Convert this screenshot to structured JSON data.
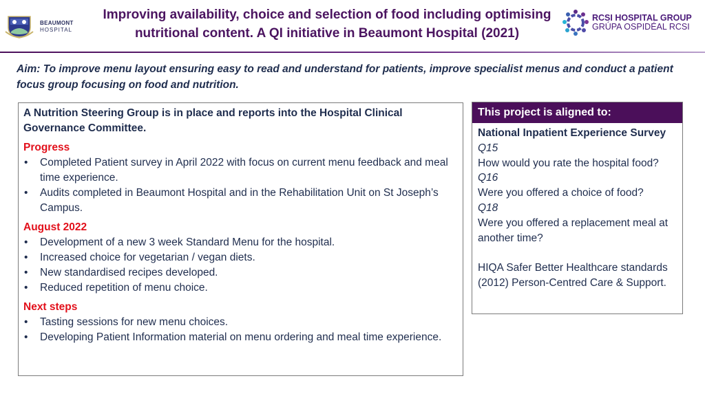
{
  "header": {
    "title_line1": "Improving availability, choice and selection of food including optimising",
    "title_line2": "nutritional content. A QI initiative in Beaumont Hospital (2021)",
    "left_logo": {
      "icon": "beaumont-crest-icon",
      "line1": "BEAUMONT",
      "line2": "HOSPITAL"
    },
    "right_logo": {
      "icon": "rcsi-people-circle-icon",
      "line1": "RCSI HOSPITAL GROUP",
      "line2": "GRÚPA OSPIDÉAL RCSI"
    }
  },
  "aim": {
    "label": "Aim",
    "text": ": To improve menu layout ensuring easy to read and understand for patients, improve specialist menus and conduct a patient focus group focusing on food and nutrition."
  },
  "left_panel": {
    "intro": "A Nutrition Steering Group is in place and reports into the Hospital Clinical Governance Committee.",
    "sections": [
      {
        "heading": "Progress",
        "items": [
          "Completed Patient survey in April 2022 with focus on current menu feedback and meal time experience.",
          "Audits completed in Beaumont Hospital and in the Rehabilitation Unit on St Joseph’s Campus."
        ]
      },
      {
        "heading": "August 2022",
        "items": [
          "Development of a new 3 week Standard Menu for the hospital.",
          "Increased choice for vegetarian / vegan diets.",
          "New standardised recipes developed.",
          "Reduced repetition of menu choice."
        ]
      },
      {
        "heading": "Next steps",
        "items": [
          "Tasting sessions for new menu choices.",
          "Developing Patient Information material on menu ordering and meal time experience."
        ]
      }
    ]
  },
  "right_panel": {
    "header": "This project is aligned to:",
    "survey_title": "National Inpatient Experience Survey",
    "questions": [
      {
        "number": "Q15",
        "text": "How would you rate the hospital food?"
      },
      {
        "number": "Q16",
        "text": "Were you offered a choice of food?"
      },
      {
        "number": "Q18",
        "text": "Were you offered a replacement meal at another time?"
      }
    ],
    "standards": "HIQA Safer Better Healthcare standards (2012) Person-Centred Care & Support."
  },
  "colors": {
    "title": "#4b1460",
    "accent_purple": "#4b0f5a",
    "heading_red": "#e2101b",
    "body_text": "#1f2d4e"
  }
}
